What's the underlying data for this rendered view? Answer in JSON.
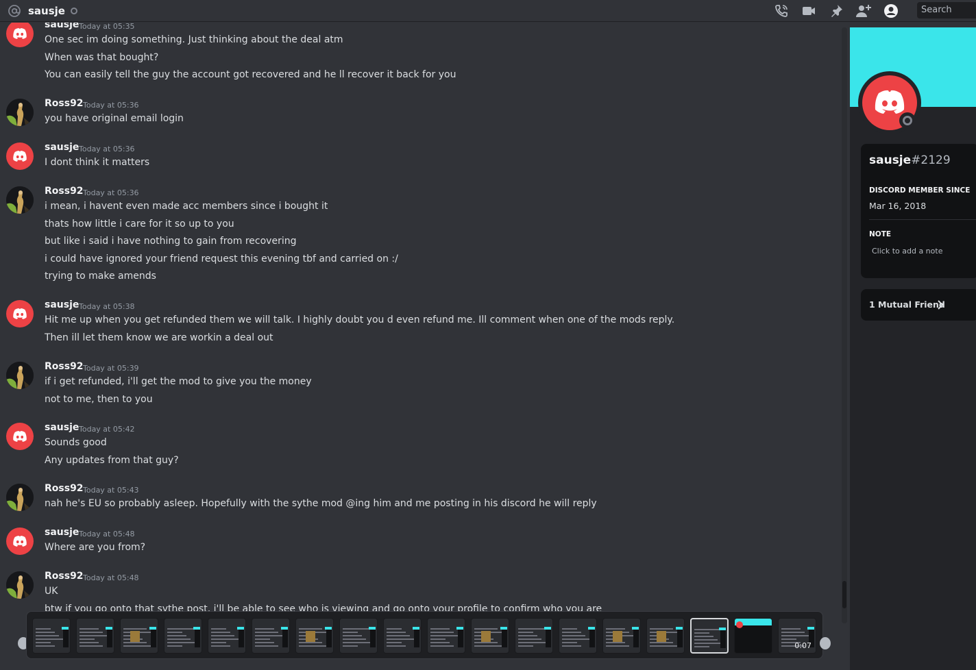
{
  "header": {
    "title": "sausje",
    "search_placeholder": "Search",
    "icons": [
      "at-icon",
      "voice-call-icon",
      "video-call-icon",
      "pin-icon",
      "add-friend-icon",
      "profile-toggle-icon"
    ]
  },
  "colors": {
    "background": "#313338",
    "discord_red": "#ed4245",
    "banner": "#3ae5ea",
    "panel": "#232428"
  },
  "messages": [
    {
      "author": "sausje",
      "time": "Today at 05:35",
      "lines": [
        "One sec im doing something. Just thinking about the deal atm",
        "When was that bought?",
        "You can easily tell the guy the account got recovered and he ll recover it back for you"
      ]
    },
    {
      "author": "Ross92",
      "time": "Today at 05:36",
      "lines": [
        "you have original email login"
      ]
    },
    {
      "author": "sausje",
      "time": "Today at 05:36",
      "lines": [
        "I dont think it matters"
      ]
    },
    {
      "author": "Ross92",
      "time": "Today at 05:36",
      "lines": [
        "i mean, i havent even made acc members since i bought it",
        "thats how little i care for it so up to you",
        "but like i said i have nothing to gain from recovering",
        "i could have ignored your friend request this evening tbf and carried on :/",
        "trying to make amends"
      ]
    },
    {
      "author": "sausje",
      "time": "Today at 05:38",
      "lines": [
        "Hit me up when you get refunded them we will talk. I highly doubt you d even refund me. Ill comment when one of the mods reply.",
        "Then ill let them know we are workin a deal out"
      ]
    },
    {
      "author": "Ross92",
      "time": "Today at 05:39",
      "lines": [
        "if i get refunded, i'll get the mod to give you the money",
        "not to me, then to you"
      ]
    },
    {
      "author": "sausje",
      "time": "Today at 05:42",
      "lines": [
        "Sounds good",
        "Any updates from that guy?"
      ]
    },
    {
      "author": "Ross92",
      "time": "Today at 05:43",
      "lines": [
        "nah he's EU so probably asleep. Hopefully with the sythe mod @ing him and me posting in his discord he will reply"
      ]
    },
    {
      "author": "sausje",
      "time": "Today at 05:48",
      "lines": [
        "Where are you from?"
      ]
    },
    {
      "author": "Ross92",
      "time": "Today at 05:48",
      "lines": [
        "UK",
        "btw if you go onto that sythe post, i'll be able to see who is viewing and go onto your profile to confirm who you are"
      ]
    }
  ],
  "profile": {
    "username": "sausje",
    "discriminator": "#2129",
    "member_since_label": "DISCORD MEMBER SINCE",
    "member_since": "Mar 16, 2018",
    "note_label": "NOTE",
    "note_placeholder": "Click to add a note",
    "mutual_friends": "1 Mutual Friend"
  },
  "video": {
    "time": "0:07",
    "thumbnail_count": 18,
    "selected_index": 15
  }
}
